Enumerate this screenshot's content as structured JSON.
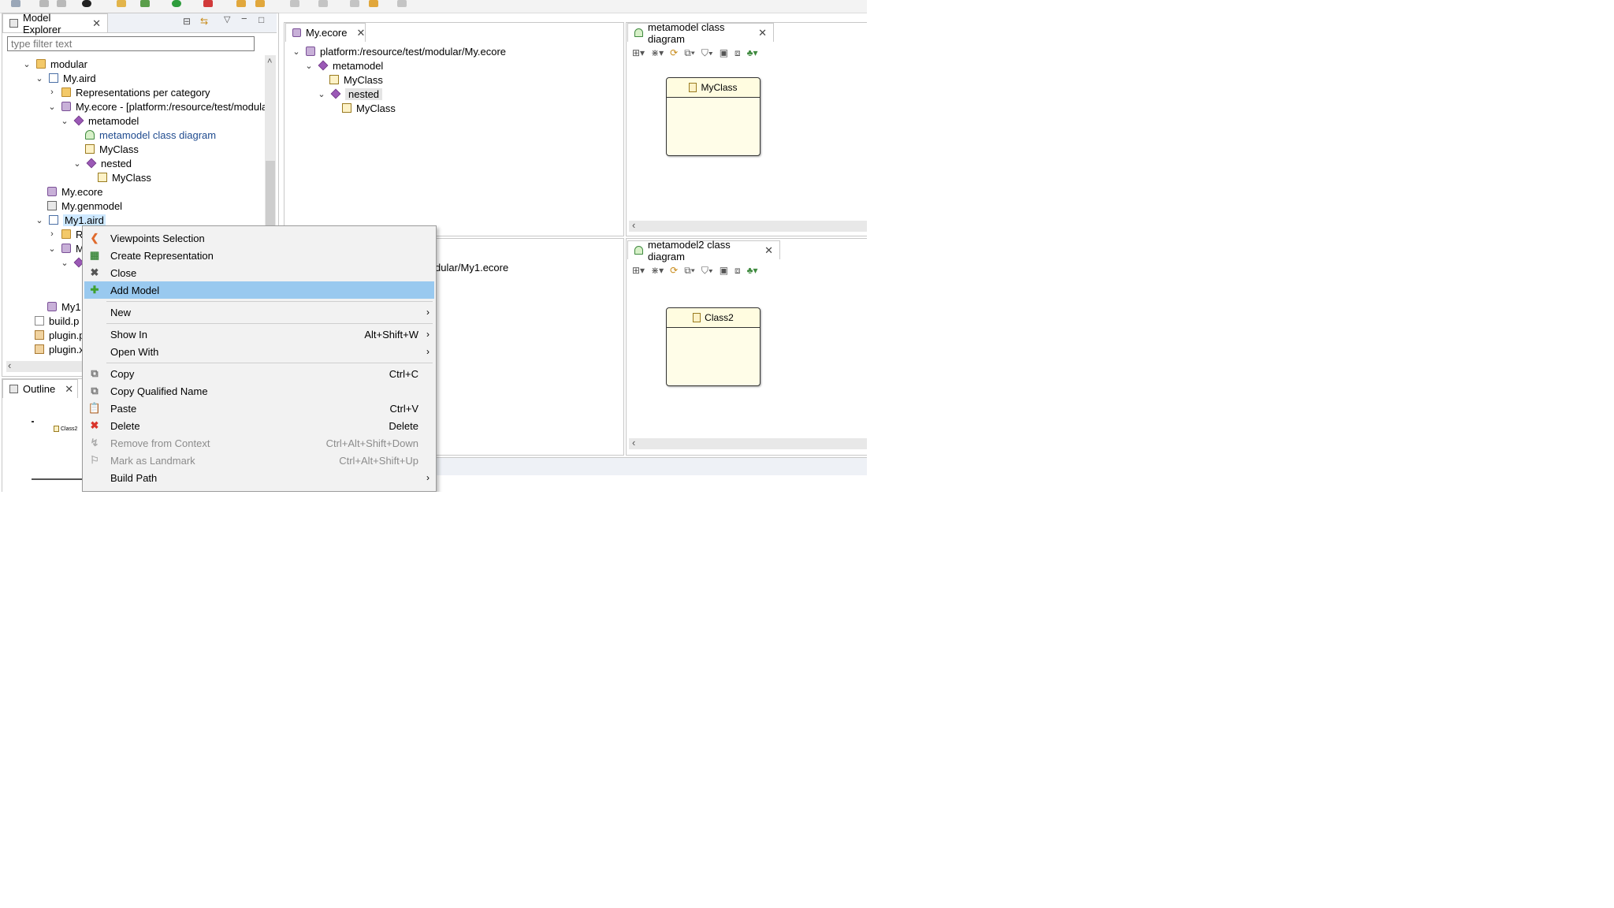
{
  "explorer": {
    "tab_title": "Model Explorer",
    "filter_placeholder": "type filter text",
    "tree": [
      {
        "label": "modular"
      },
      {
        "label": "My.aird"
      },
      {
        "label": "Representations per category"
      },
      {
        "label": "My.ecore - [platform:/resource/test/modula"
      },
      {
        "label": "metamodel"
      },
      {
        "label": "metamodel class diagram"
      },
      {
        "label": "MyClass"
      },
      {
        "label": "nested"
      },
      {
        "label": "MyClass"
      },
      {
        "label": "My.ecore"
      },
      {
        "label": "My.genmodel"
      },
      {
        "label": "My1.aird"
      },
      {
        "label": "R"
      },
      {
        "label": "M"
      },
      {
        "label": "My1"
      },
      {
        "label": "build.p"
      },
      {
        "label": "plugin.p"
      },
      {
        "label": "plugin.x"
      }
    ]
  },
  "outline": {
    "tab_title": "Outline",
    "mini_label": "Class2"
  },
  "ecore_editor": {
    "tab_title": "My.ecore",
    "tree": [
      {
        "label": "platform:/resource/test/modular/My.ecore"
      },
      {
        "label": "metamodel"
      },
      {
        "label": "MyClass"
      },
      {
        "label": "nested"
      },
      {
        "label": "MyClass"
      }
    ],
    "lower_path": "dular/My1.ecore"
  },
  "diagram1": {
    "tab_title": "metamodel class diagram",
    "node_label": "MyClass"
  },
  "diagram2": {
    "tab_title": "metamodel2 class diagram",
    "node_label": "Class2"
  },
  "context_menu": {
    "items": [
      {
        "label": "Viewpoints Selection",
        "shortcut": "",
        "icon": "viewpoints-icon"
      },
      {
        "label": "Create Representation",
        "shortcut": "",
        "icon": "create-representation-icon"
      },
      {
        "label": "Close",
        "shortcut": "",
        "icon": "close-icon"
      },
      {
        "label": "Add Model",
        "shortcut": "",
        "icon": "add-icon"
      },
      {
        "label": "New",
        "shortcut": "",
        "icon": ""
      },
      {
        "label": "Show In",
        "shortcut": "Alt+Shift+W",
        "icon": ""
      },
      {
        "label": "Open With",
        "shortcut": "",
        "icon": ""
      },
      {
        "label": "Copy",
        "shortcut": "Ctrl+C",
        "icon": "copy-icon"
      },
      {
        "label": "Copy Qualified Name",
        "shortcut": "",
        "icon": "copy-qualified-icon"
      },
      {
        "label": "Paste",
        "shortcut": "Ctrl+V",
        "icon": "paste-icon"
      },
      {
        "label": "Delete",
        "shortcut": "Delete",
        "icon": "delete-icon"
      },
      {
        "label": "Remove from Context",
        "shortcut": "Ctrl+Alt+Shift+Down",
        "icon": "remove-icon"
      },
      {
        "label": "Mark as Landmark",
        "shortcut": "Ctrl+Alt+Shift+Up",
        "icon": "landmark-icon"
      },
      {
        "label": "Build Path",
        "shortcut": "",
        "icon": ""
      }
    ],
    "selected_color": "#99c9ef",
    "delete_color": "#d9342b"
  }
}
